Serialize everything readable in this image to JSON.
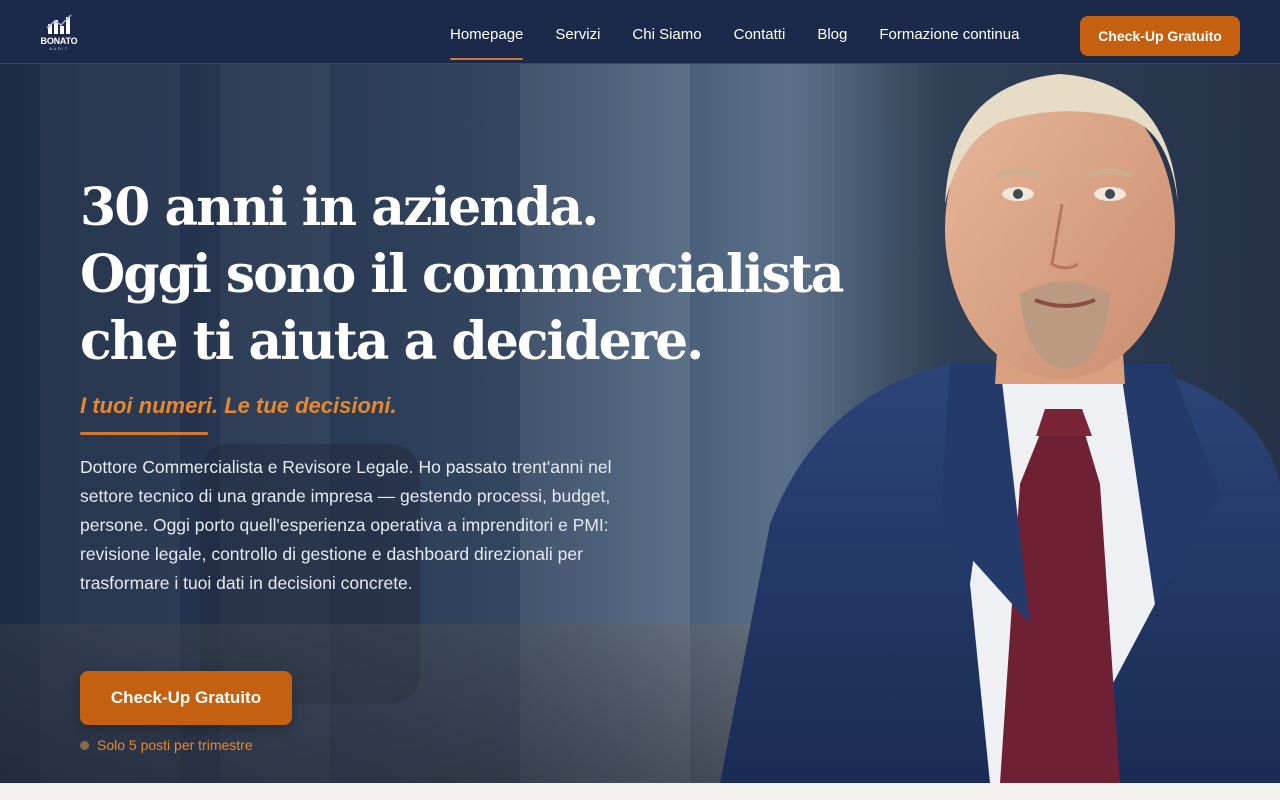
{
  "brand": {
    "name": "BONATO",
    "sub": "AUDIT"
  },
  "nav": {
    "items": [
      {
        "label": "Homepage",
        "active": true
      },
      {
        "label": "Servizi"
      },
      {
        "label": "Chi Siamo"
      },
      {
        "label": "Contatti"
      },
      {
        "label": "Blog"
      },
      {
        "label": "Formazione continua"
      }
    ],
    "cta_label": "Check-Up Gratuito"
  },
  "hero": {
    "title_lines": [
      "30 anni in azienda.",
      "Oggi sono il commercialista",
      "che ti aiuta a decidere."
    ],
    "tagline": "I tuoi numeri. Le tue decisioni.",
    "description": "Dottore Commercialista e Revisore Legale. Ho passato trent'anni nel settore tecnico di una grande impresa — gestendo processi, budget, persone. Oggi porto quell'esperienza operativa a imprenditori e PMI: revisione legale, controllo di gestione e dashboard direzionali per trasformare i tuoi dati in decisioni concrete.",
    "cta_label": "Check-Up Gratuito",
    "scarcity": "Solo 5 posti per trimestre"
  },
  "colors": {
    "navy": "#1b2a4a",
    "accent": "#c4600f",
    "accent_text": "#e8872e"
  }
}
